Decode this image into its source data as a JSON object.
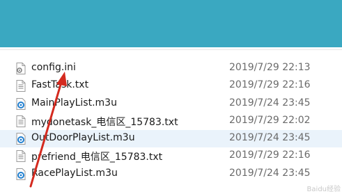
{
  "files": [
    {
      "name": "config.ini",
      "date": "2019/7/29 22:13",
      "icon": "settings-file-icon",
      "selected": false
    },
    {
      "name": "FastTask.txt",
      "date": "2019/7/29 22:16",
      "icon": "text-file-icon",
      "selected": false
    },
    {
      "name": "MainPlayList.m3u",
      "date": "2019/7/24 23:45",
      "icon": "media-playlist-icon",
      "selected": false
    },
    {
      "name": "mydonetask_电信区_15783.txt",
      "date": "2019/7/29 22:02",
      "icon": "text-file-icon",
      "selected": false
    },
    {
      "name": "OutDoorPlayList.m3u",
      "date": "2019/7/24 23:45",
      "icon": "media-playlist-icon",
      "selected": true
    },
    {
      "name": "prefriend_电信区_15783.txt",
      "date": "2019/7/29 22:16",
      "icon": "text-file-icon",
      "selected": false
    },
    {
      "name": "RacePlayList.m3u",
      "date": "2019/7/24 23:45",
      "icon": "media-playlist-icon",
      "selected": false
    }
  ],
  "colors": {
    "titlebar": "#3aa8c1",
    "selected_row": "#eaf3fb",
    "arrow": "#d42a1f"
  },
  "watermark": "Baidu经验"
}
